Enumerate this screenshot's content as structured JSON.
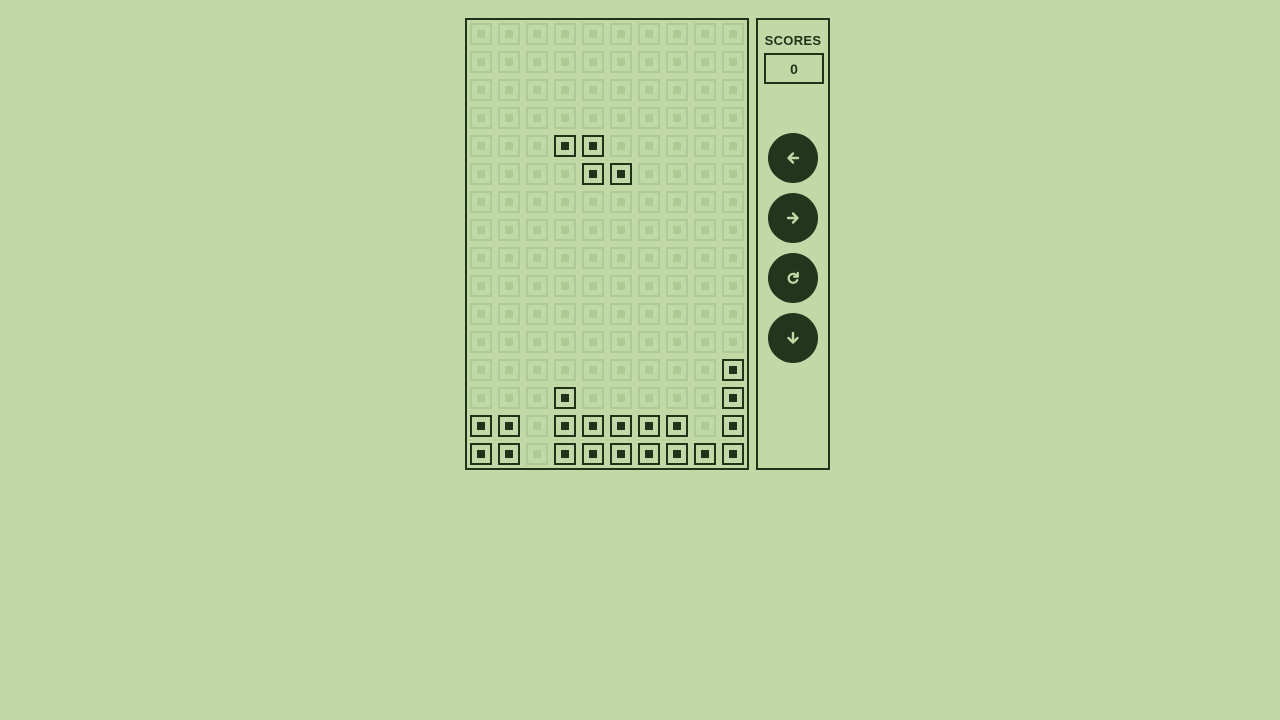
{
  "colors": {
    "background": "#c0d9a6",
    "dark": "#1f3319",
    "off_cell": "#aeca95",
    "button": "#23361d",
    "button_icon": "#c0d9a6"
  },
  "scores": {
    "label": "SCORES",
    "value": "0"
  },
  "controls": [
    {
      "name": "move-left-button",
      "icon": "arrow-left-icon"
    },
    {
      "name": "move-right-button",
      "icon": "arrow-right-icon"
    },
    {
      "name": "rotate-button",
      "icon": "rotate-icon"
    },
    {
      "name": "drop-button",
      "icon": "arrow-down-icon"
    }
  ],
  "board": {
    "columns": 10,
    "rows": 16,
    "cells": [
      "0000000000",
      "0000000000",
      "0000000000",
      "0000000000",
      "0001100000",
      "0000110000",
      "0000000000",
      "0000000000",
      "0000000000",
      "0000000000",
      "0000000000",
      "0000000000",
      "0000000001",
      "0001000001",
      "1101111101",
      "1101111111"
    ]
  }
}
